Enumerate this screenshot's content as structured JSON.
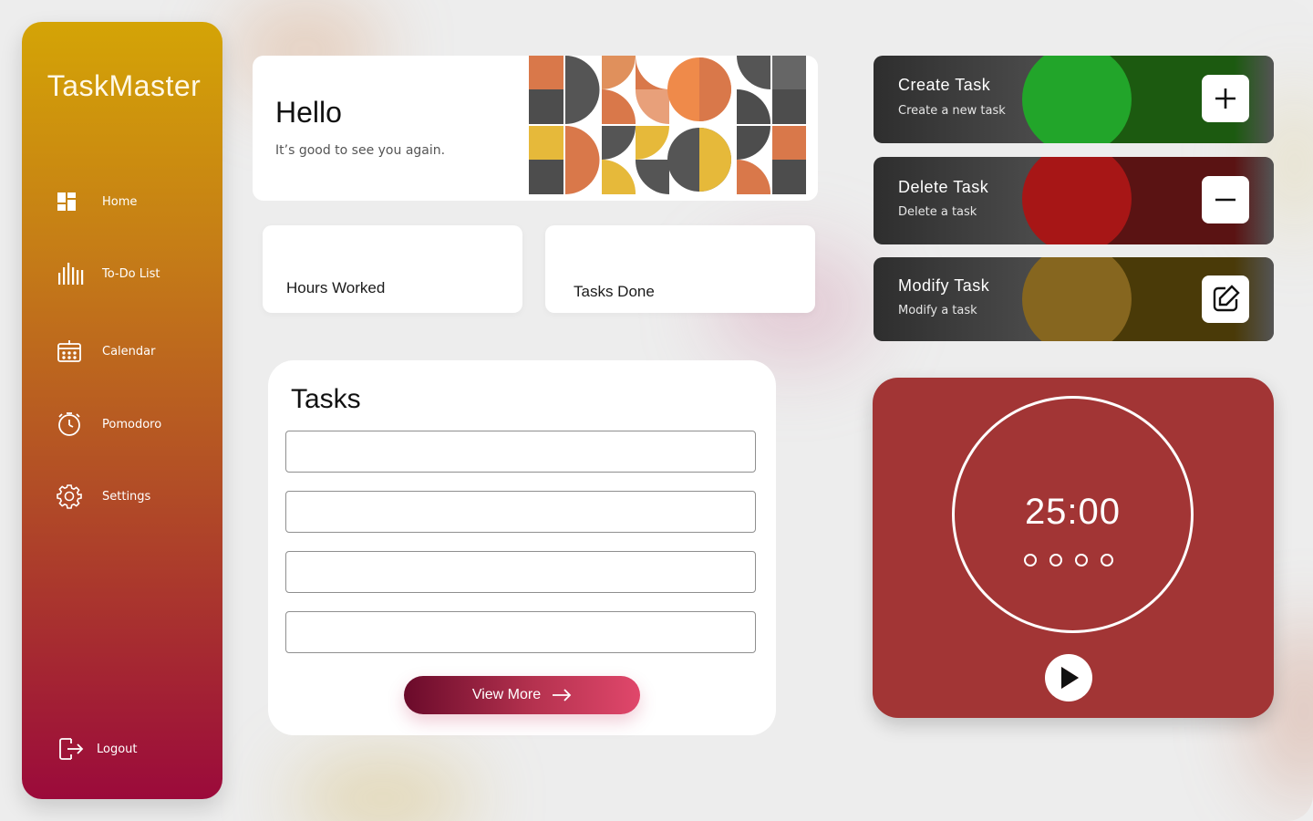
{
  "app": {
    "brand": "TaskMaster"
  },
  "sidebar": {
    "items": [
      {
        "label": "Home",
        "icon": "dashboard-icon"
      },
      {
        "label": "To-Do List",
        "icon": "list-bars-icon"
      },
      {
        "label": "Calendar",
        "icon": "calendar-icon"
      },
      {
        "label": "Pomodoro",
        "icon": "stopwatch-icon"
      },
      {
        "label": "Settings",
        "icon": "gear-icon"
      }
    ],
    "logout": {
      "label": "Logout",
      "icon": "logout-icon"
    }
  },
  "greeting": {
    "title": "Hello",
    "subtitle": "It’s good to see you again."
  },
  "stats": {
    "hours_label": "Hours Worked",
    "tasks_label": "Tasks Done"
  },
  "tasks": {
    "title": "Tasks",
    "inputs": [
      "",
      "",
      "",
      ""
    ],
    "view_more_label": "View More"
  },
  "actions": [
    {
      "title": "Create Task",
      "subtitle": "Create a new task",
      "icon": "plus-icon",
      "accent": "#22a52a",
      "tail": "#1c5a10"
    },
    {
      "title": "Delete Task",
      "subtitle": "Delete a task",
      "icon": "minus-icon",
      "accent": "#a71616",
      "tail": "#5a1313"
    },
    {
      "title": "Modify Task",
      "subtitle": "Modify a task",
      "icon": "edit-icon",
      "accent": "#86661f",
      "tail": "#4a3a08"
    }
  ],
  "pomodoro": {
    "time": "25:00",
    "sessions": 4,
    "completed_sessions": 0,
    "play_icon": "play-icon"
  },
  "colors": {
    "sidebar_top": "#d4a406",
    "sidebar_bottom": "#9b0a3b",
    "pomodoro_bg": "#a23535",
    "view_more_start": "#6a0a2a",
    "view_more_end": "#e0476b"
  }
}
